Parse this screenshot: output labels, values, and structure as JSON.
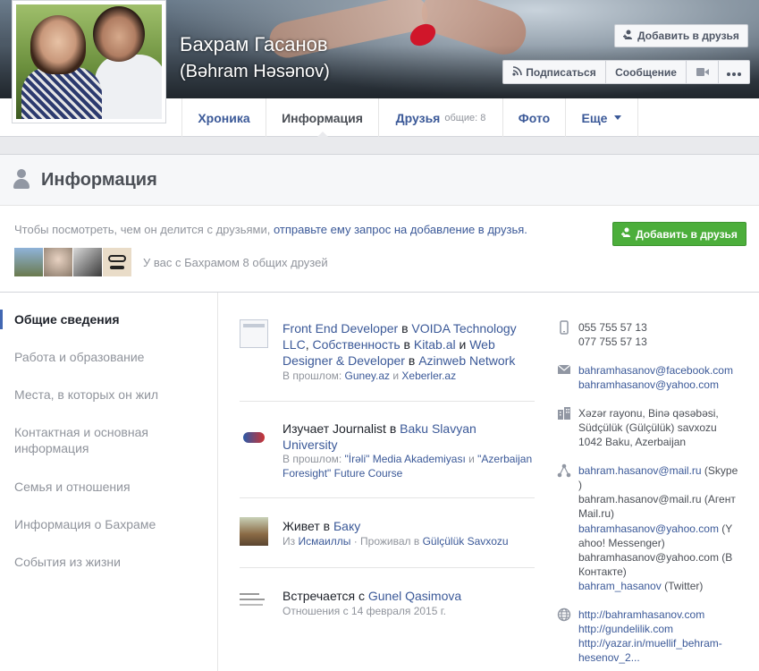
{
  "profile": {
    "name": "Бахрам Гасанов",
    "alt_name": "(Bəhram Həsənov)"
  },
  "cover_actions": {
    "add_friend": "Добавить в друзья",
    "subscribe": "Подписаться",
    "message": "Сообщение"
  },
  "tabs": [
    {
      "label": "Хроника"
    },
    {
      "label": "Информация"
    },
    {
      "label": "Друзья",
      "meta": "общие: 8"
    },
    {
      "label": "Фото"
    },
    {
      "label": "Еще"
    }
  ],
  "section": {
    "title": "Информация",
    "request_text_prefix": "Чтобы посмотреть, чем он делится с друзьями, ",
    "request_link": "отправьте ему запрос на добавление в друзья.",
    "add_friend_button": "Добавить в друзья",
    "mutual_text": "У вас с Бахрамом 8 общих друзей"
  },
  "left_nav": [
    {
      "label": "Общие сведения"
    },
    {
      "label": "Работа и образование"
    },
    {
      "label": "Места, в которых он жил"
    },
    {
      "label": "Контактная и основная информация"
    },
    {
      "label": "Семья и отношения"
    },
    {
      "label": "Информация о Бахраме"
    },
    {
      "label": "События из жизни"
    }
  ],
  "overview": {
    "work": {
      "line1_link1": "Front End Developer",
      "line1_in": " в ",
      "line1_link2": "VOIDA Technology LLC",
      "line1_sep1": ", ",
      "line1_link3": "Собственность",
      "line1_in2": " в ",
      "line1_link4": "Kitab.al",
      "line1_and": " и ",
      "line1_link5": "Web Designer & Developer",
      "line1_in3": " в ",
      "line1_link6": "Azinweb Network",
      "past_label": "В прошлом: ",
      "past1": "Guney.az",
      "past_and": " и ",
      "past2": "Xeberler.az"
    },
    "education": {
      "prefix": "Изучает Journalist в ",
      "school": "Baku Slavyan University",
      "past_label": "В прошлом: ",
      "past1": "\"İrəli\" Media Akademiyası",
      "past_and": " и ",
      "past2": "\"Azerbaijan Foresight\" Future Course"
    },
    "lives": {
      "prefix": "Живет в ",
      "city": "Баку",
      "from_label": "Из ",
      "from": "Исмаиллы",
      "lived_label": " · Проживал в ",
      "lived": "Gülçülük Savxozu"
    },
    "relationship": {
      "prefix": "Встречается с ",
      "partner": "Gunel Qasimova",
      "since": "Отношения с 14 февраля 2015 г."
    }
  },
  "contacts": {
    "phone1": "055 755 57 13",
    "phone2": "077 755 57 13",
    "email1": "bahramhasanov@facebook.com",
    "email2": "bahramhasanov@yahoo.com",
    "address_line1": "Xəzər rayonu, Binə qəsəbəsi,",
    "address_line2": "Südçülük (Gülçülük) savxozu",
    "address_line3": "1042 Baku, Azerbaijan",
    "im": [
      {
        "handle": "bahram.hasanov@mail.ru",
        "service": " (Skype"
      },
      {
        "handle": "",
        "service": ")"
      },
      {
        "handle": "bahram.hasanov@mail.ru",
        "service": " (Агент"
      },
      {
        "handle": "",
        "service": "Mail.ru)"
      },
      {
        "handle": "bahramhasanov@yahoo.com",
        "service": " (Y"
      },
      {
        "handle": "",
        "service": "ahoo! Messenger)"
      },
      {
        "handle": "bahramhasanov@yahoo.com",
        "service": " (В"
      },
      {
        "handle": "",
        "service": "Контакте)"
      },
      {
        "handle": "bahram_hasanov",
        "service": " (Twitter)"
      }
    ],
    "site1": "http://bahramhasanov.com",
    "site2": "http://gundelilik.com",
    "site3": "http://yazar.in/muellif_behram-",
    "site3b": "hesenov_2..."
  }
}
